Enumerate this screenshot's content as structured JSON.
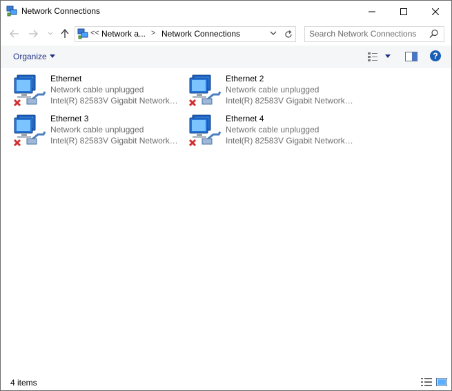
{
  "window": {
    "title": "Network Connections"
  },
  "nav": {
    "back_label": "←",
    "forward_label": "→",
    "recent_label": "⌄",
    "up_label": "↑"
  },
  "address": {
    "overflow": "<<",
    "segments": [
      "Network a...",
      "Network Connections"
    ],
    "separator": ">"
  },
  "search": {
    "placeholder": "Search Network Connections"
  },
  "commandbar": {
    "organize_label": "Organize",
    "help_label": "?"
  },
  "items": [
    {
      "name": "Ethernet",
      "status": "Network cable unplugged",
      "device": "Intel(R) 82583V Gigabit Network C..."
    },
    {
      "name": "Ethernet 2",
      "status": "Network cable unplugged",
      "device": "Intel(R) 82583V Gigabit Network C..."
    },
    {
      "name": "Ethernet 3",
      "status": "Network cable unplugged",
      "device": "Intel(R) 82583V Gigabit Network C..."
    },
    {
      "name": "Ethernet 4",
      "status": "Network cable unplugged",
      "device": "Intel(R) 82583V Gigabit Network C..."
    }
  ],
  "statusbar": {
    "count": "4 items"
  },
  "colors": {
    "accent": "#1e3287",
    "muted_text": "#6d6d6d",
    "help_blue": "#1a5fb4",
    "error_red": "#d32f2f"
  }
}
